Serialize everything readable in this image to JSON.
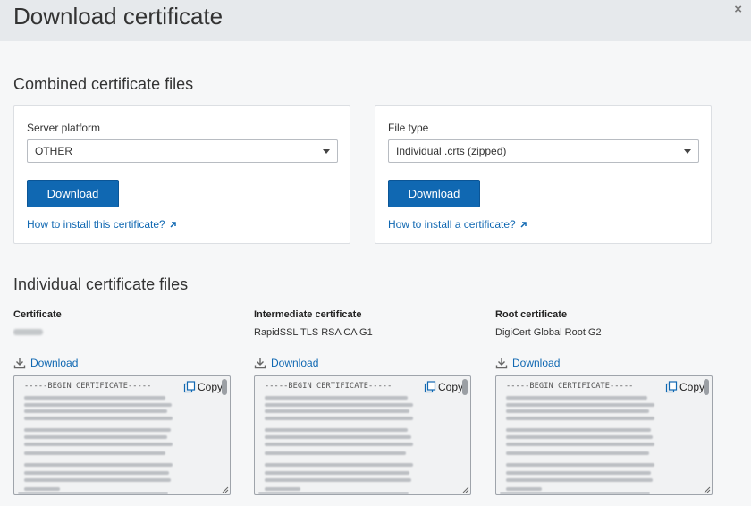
{
  "dialog": {
    "title": "Download certificate",
    "close_symbol": "×"
  },
  "combined": {
    "title": "Combined certificate files",
    "server_card": {
      "label": "Server platform",
      "selected": "OTHER",
      "button": "Download",
      "link": "How to install this certificate?"
    },
    "filetype_card": {
      "label": "File type",
      "selected": "Individual .crts (zipped)",
      "button": "Download",
      "link": "How to install a certificate?"
    }
  },
  "individual": {
    "title": "Individual certificate files",
    "columns": [
      {
        "label": "Certificate",
        "name": "",
        "download": "Download",
        "pem_begin": "-----BEGIN CERTIFICATE-----",
        "copy": "Copy"
      },
      {
        "label": "Intermediate certificate",
        "name": "RapidSSL TLS RSA CA G1",
        "download": "Download",
        "pem_begin": "-----BEGIN CERTIFICATE-----",
        "copy": "Copy"
      },
      {
        "label": "Root certificate",
        "name": "DigiCert Global Root G2",
        "download": "Download",
        "pem_begin": "-----BEGIN CERTIFICATE-----",
        "copy": "Copy"
      }
    ]
  },
  "icons": {
    "close": "close-icon",
    "external": "external-link-icon",
    "download": "download-icon",
    "copy": "copy-icon",
    "dropdown": "chevron-down-icon"
  },
  "colors": {
    "accent": "#1068b2",
    "header_bg": "#e6e9ec",
    "page_bg": "#f6f7f8"
  }
}
